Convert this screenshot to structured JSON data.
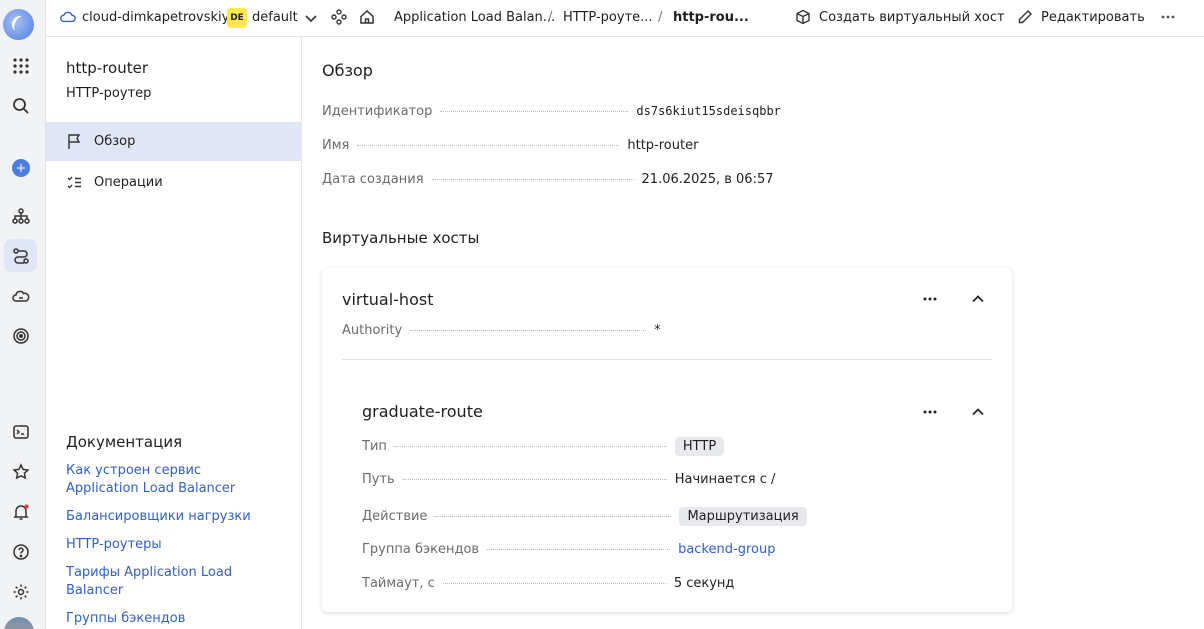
{
  "topbar": {
    "cloud": "cloud-dimkapetrovskiy",
    "folder_badge": "DE",
    "folder": "default",
    "breadcrumbs": [
      "Application Load Balan...",
      "HTTP-роуте...",
      "http-rou..."
    ],
    "separator": "/",
    "create_vhost": "Создать виртуальный хост",
    "edit": "Редактировать"
  },
  "sidebar": {
    "title": "http-router",
    "subtitle": "HTTP-роутер",
    "nav": [
      {
        "label": "Обзор",
        "icon": "flag-icon",
        "active": true
      },
      {
        "label": "Операции",
        "icon": "checklist-icon",
        "active": false
      }
    ],
    "docs_title": "Документация",
    "docs": [
      "Как устроен сервис Application Load Balancer",
      "Балансировщики нагрузки",
      "HTTP-роутеры",
      "Тарифы Application Load Balancer",
      "Группы бэкендов"
    ]
  },
  "overview": {
    "heading": "Обзор",
    "fields": [
      {
        "label": "Идентификатор",
        "value": "ds7s6kiut15sdeisqbbr"
      },
      {
        "label": "Имя",
        "value": "http-router"
      },
      {
        "label": "Дата создания",
        "value": "21.06.2025, в 06:57"
      }
    ]
  },
  "virtual_hosts": {
    "heading": "Виртуальные хосты",
    "host": {
      "name": "virtual-host",
      "authority_label": "Authority",
      "authority_value": "*",
      "route": {
        "name": "graduate-route",
        "fields": [
          {
            "label": "Тип",
            "value": "HTTP"
          },
          {
            "label": "Путь",
            "value": "Начинается с /"
          },
          {
            "label": "Действие",
            "value": "Маршрутизация"
          },
          {
            "label": "Группа бэкендов",
            "value": "backend-group"
          },
          {
            "label": "Таймаут, с",
            "value": "5 секунд"
          }
        ]
      }
    }
  },
  "colors": {
    "accent": "#2f5fd0",
    "active_bg": "#e1e6f7",
    "badge_yellow": "#ffe84a",
    "rail_accent": "#4b7ce2"
  }
}
